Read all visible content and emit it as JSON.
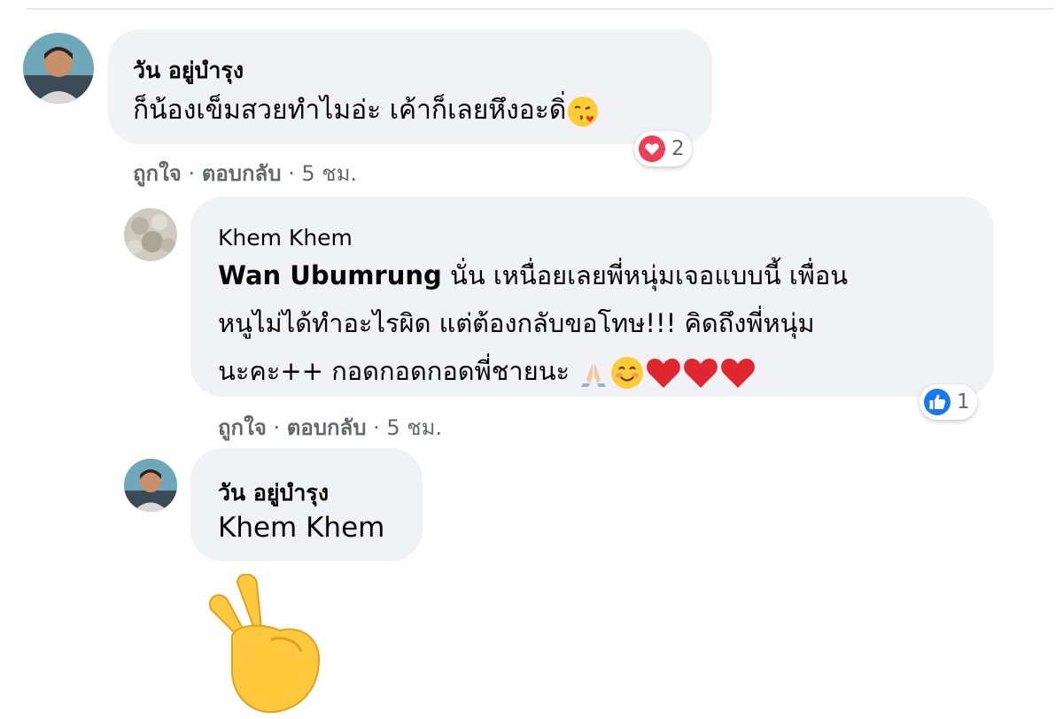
{
  "comments": [
    {
      "author": "วัน อยู่บำรุง",
      "text": "ก็น้องเข็มสวยทำไมอ่ะ เค้าก็เลยหึงอะดิ่",
      "emoji": "kissing-face-heart-emoji",
      "reaction": {
        "type": "heart",
        "count": "2"
      },
      "actions": {
        "like": "ถูกใจ",
        "sep": "·",
        "reply": "ตอบกลับ",
        "time": "5 ชม."
      }
    },
    {
      "author": "Khem Khem",
      "mention": "Wan Ubumrung",
      "line1": " นั่น เหนื่อยเลยพี่หนุ่มเจอแบบนี้ เพื่อน",
      "line2": "หนูไม่ได้ทำอะไรผิด แต่ต้องกลับขอโทษ!!! คิดถึงพี่หนุ่ม",
      "line3": "นะคะ++ กอดกอดกอดพี่ชายนะ",
      "emojis": [
        "folded-hands-emoji",
        "smiling-face-emoji",
        "red-heart-emoji",
        "red-heart-emoji",
        "red-heart-emoji"
      ],
      "reaction": {
        "type": "like",
        "count": "1"
      },
      "actions": {
        "like": "ถูกใจ",
        "sep": "·",
        "reply": "ตอบกลับ",
        "time": "5 ชม."
      }
    },
    {
      "author": "วัน อยู่บำรุง",
      "text": "Khem Khem",
      "sticker": "victory-hand-emoji"
    }
  ],
  "colors": {
    "bubble": "#f0f2f5",
    "meta": "#65676b",
    "like_blue": "#1877f2",
    "heart_red": "#f33e58"
  }
}
